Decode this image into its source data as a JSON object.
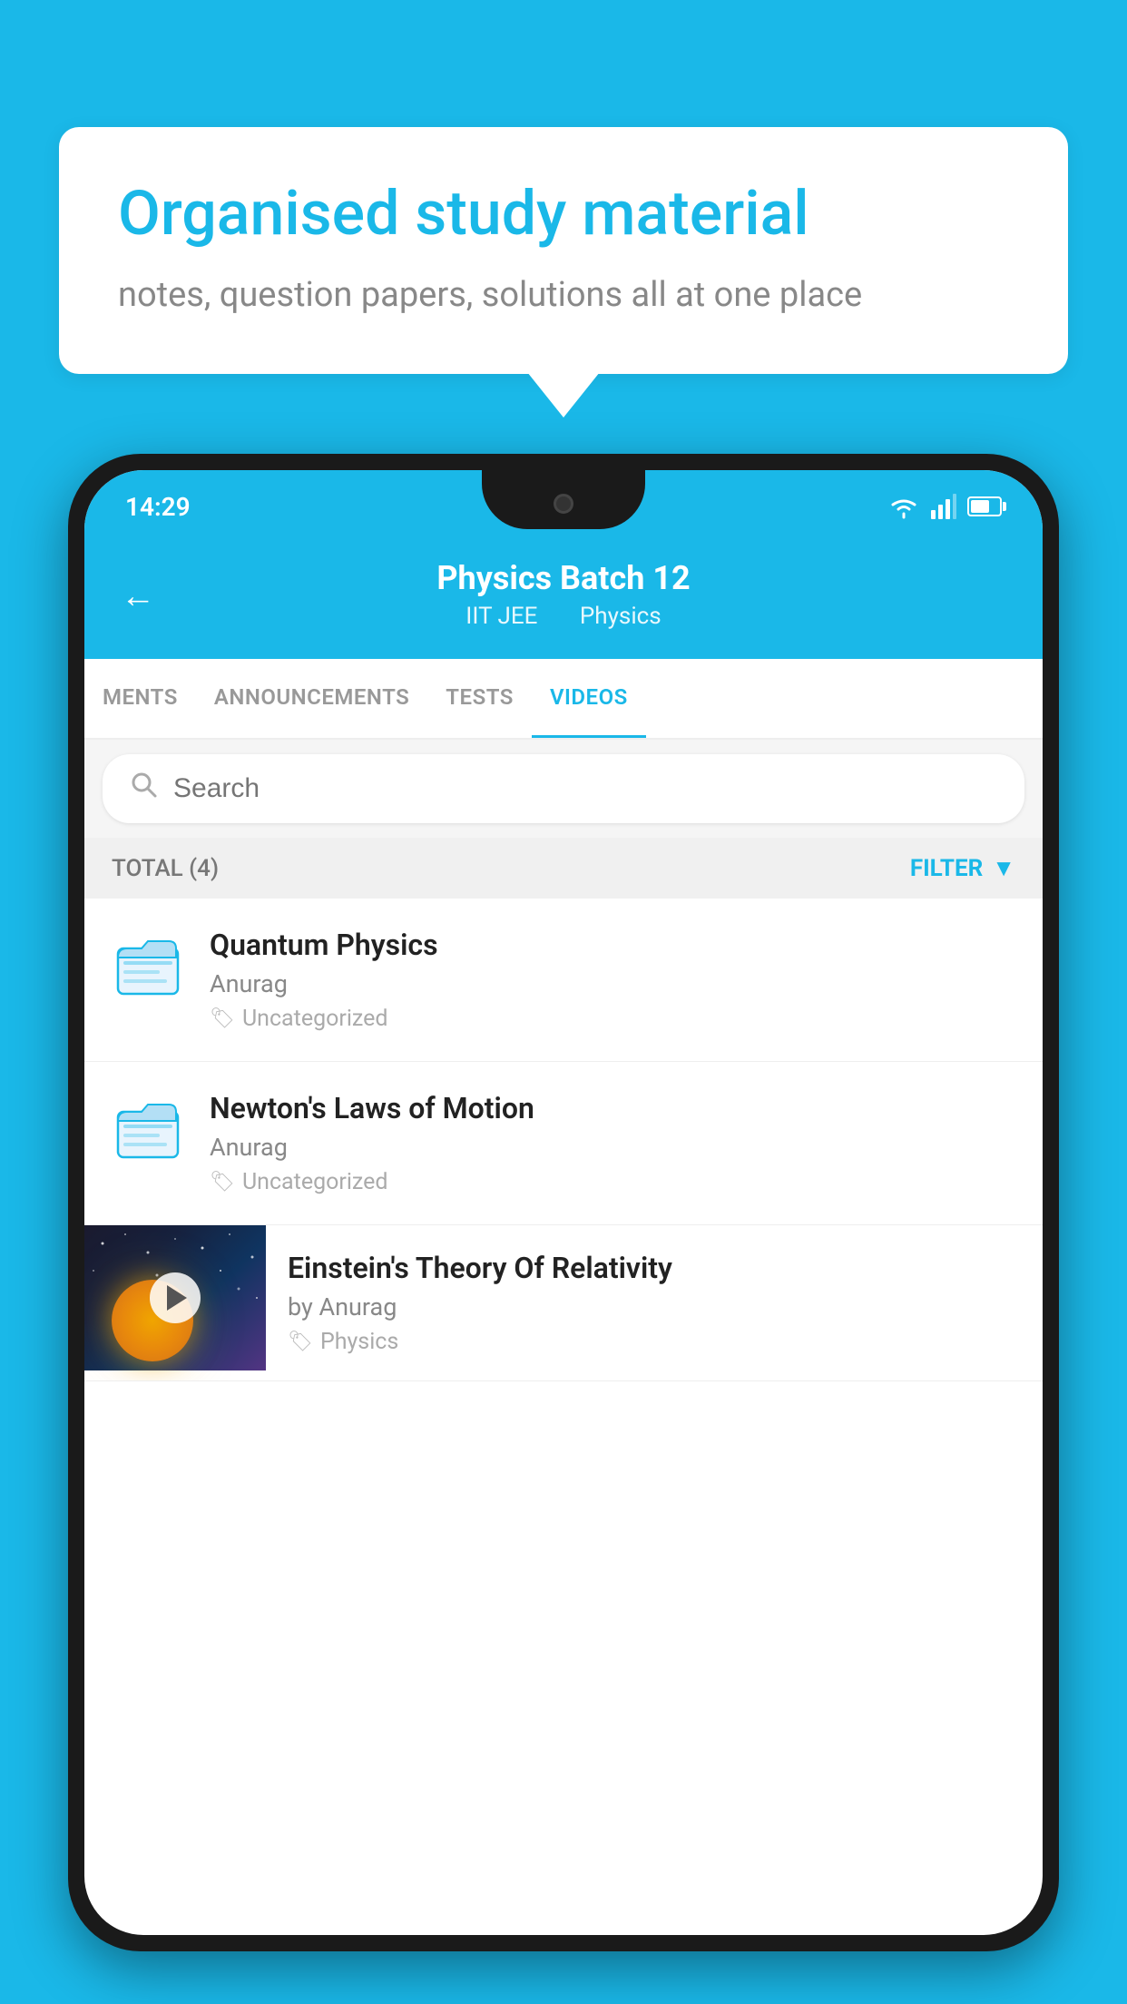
{
  "background_color": "#1ab8e8",
  "hero": {
    "title": "Organised study material",
    "subtitle": "notes, question papers, solutions all at one place"
  },
  "status_bar": {
    "time": "14:29"
  },
  "app_header": {
    "title": "Physics Batch 12",
    "subtitle_part1": "IIT JEE",
    "subtitle_part2": "Physics"
  },
  "tabs": [
    {
      "label": "MENTS",
      "active": false
    },
    {
      "label": "ANNOUNCEMENTS",
      "active": false
    },
    {
      "label": "TESTS",
      "active": false
    },
    {
      "label": "VIDEOS",
      "active": true
    }
  ],
  "search": {
    "placeholder": "Search"
  },
  "filter_bar": {
    "total_label": "TOTAL (4)",
    "filter_label": "FILTER"
  },
  "videos": [
    {
      "id": 1,
      "title": "Quantum Physics",
      "author": "Anurag",
      "tag": "Uncategorized",
      "has_thumb": false
    },
    {
      "id": 2,
      "title": "Newton's Laws of Motion",
      "author": "Anurag",
      "tag": "Uncategorized",
      "has_thumb": false
    },
    {
      "id": 3,
      "title": "Einstein's Theory Of Relativity",
      "author": "by Anurag",
      "tag": "Physics",
      "has_thumb": true
    }
  ]
}
